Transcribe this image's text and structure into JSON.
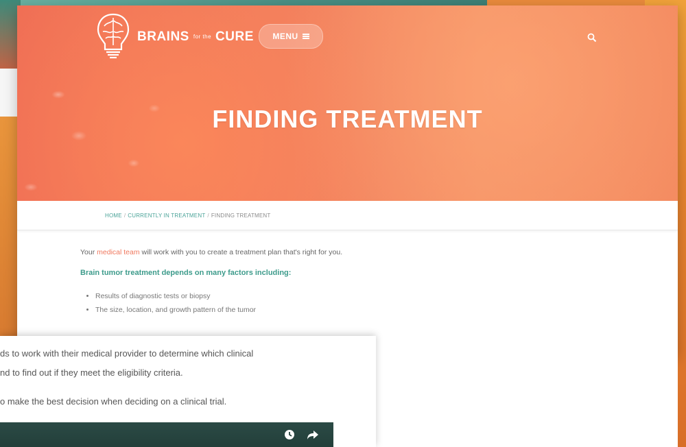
{
  "site": {
    "logo_text": "BRAINS",
    "logo_small": "for the",
    "logo_text2": "CURE",
    "menu_label": "MENU"
  },
  "hero": {
    "title": "FINDING TREATMENT"
  },
  "breadcrumb": {
    "home": "HOME",
    "parent": "CURRENTLY IN TREATMENT",
    "current": "FINDING TREATMENT",
    "separator": "/"
  },
  "content": {
    "intro_before": "Your ",
    "intro_link": "medical team",
    "intro_after": " will work with you to create a treatment plan that's right for you.",
    "subhead": "Brain tumor treatment depends on many factors including:",
    "factors": [
      "Results of diagnostic tests or biopsy",
      "The size, location, and growth pattern of the tumor"
    ]
  },
  "overlay": {
    "line1": "ds to work with their medical provider to determine which clinical",
    "line2": "nd to find out if they meet the eligibility criteria.",
    "line3": "o make the best decision when deciding on a clinical trial."
  },
  "colors": {
    "accent_teal": "#3d9b8b",
    "accent_coral": "#f0785e",
    "hero_gradient": "#f27e5d"
  },
  "icons": [
    "brain-bulb-logo-icon",
    "menu-lines-icon",
    "search-icon",
    "clock-icon",
    "share-icon"
  ]
}
